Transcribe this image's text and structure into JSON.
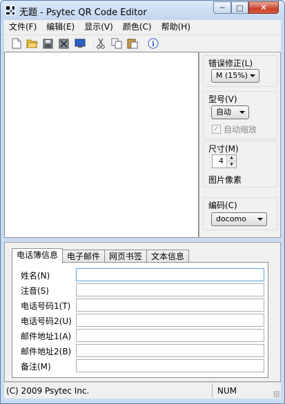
{
  "window": {
    "title": "无题 - Psytec QR Code Editor"
  },
  "window_controls": {
    "minimize": "─",
    "maximize": "□",
    "close": "✕"
  },
  "menu": [
    "文件(F)",
    "编辑(E)",
    "显示(V)",
    "颜色(C)",
    "帮助(H)"
  ],
  "toolbar": {
    "icons": [
      "new-file-icon",
      "open-folder-icon",
      "save-icon",
      "print-icon",
      "monitor-icon",
      "cut-icon",
      "copy-icon",
      "paste-icon",
      "info-icon"
    ],
    "info_glyph": "i"
  },
  "settings": {
    "error_correction": {
      "label": "错误修正(L)",
      "value": "M (15%)"
    },
    "model": {
      "label": "型号(V)",
      "value": "自动"
    },
    "auto_scale": {
      "label": "自动缩放",
      "checked": true,
      "mark": "✓"
    },
    "size": {
      "label": "尺寸(M)",
      "value": "4",
      "unit": "图片像素"
    },
    "encoding": {
      "label": "编码(C)",
      "value": "docomo"
    }
  },
  "tabs": [
    "电话簿信息",
    "电子邮件",
    "网页书签",
    "文本信息"
  ],
  "active_tab": "电话簿信息",
  "form": {
    "fields": [
      {
        "label": "姓名(N)",
        "value": ""
      },
      {
        "label": "注音(S)",
        "value": ""
      },
      {
        "label": "电话号码1(T)",
        "value": ""
      },
      {
        "label": "电话号码2(U)",
        "value": ""
      },
      {
        "label": "邮件地址1(A)",
        "value": ""
      },
      {
        "label": "邮件地址2(B)",
        "value": ""
      },
      {
        "label": "备注(M)",
        "value": ""
      }
    ]
  },
  "status": {
    "copyright": "(C) 2009 Psytec Inc.",
    "numlock": "NUM"
  }
}
